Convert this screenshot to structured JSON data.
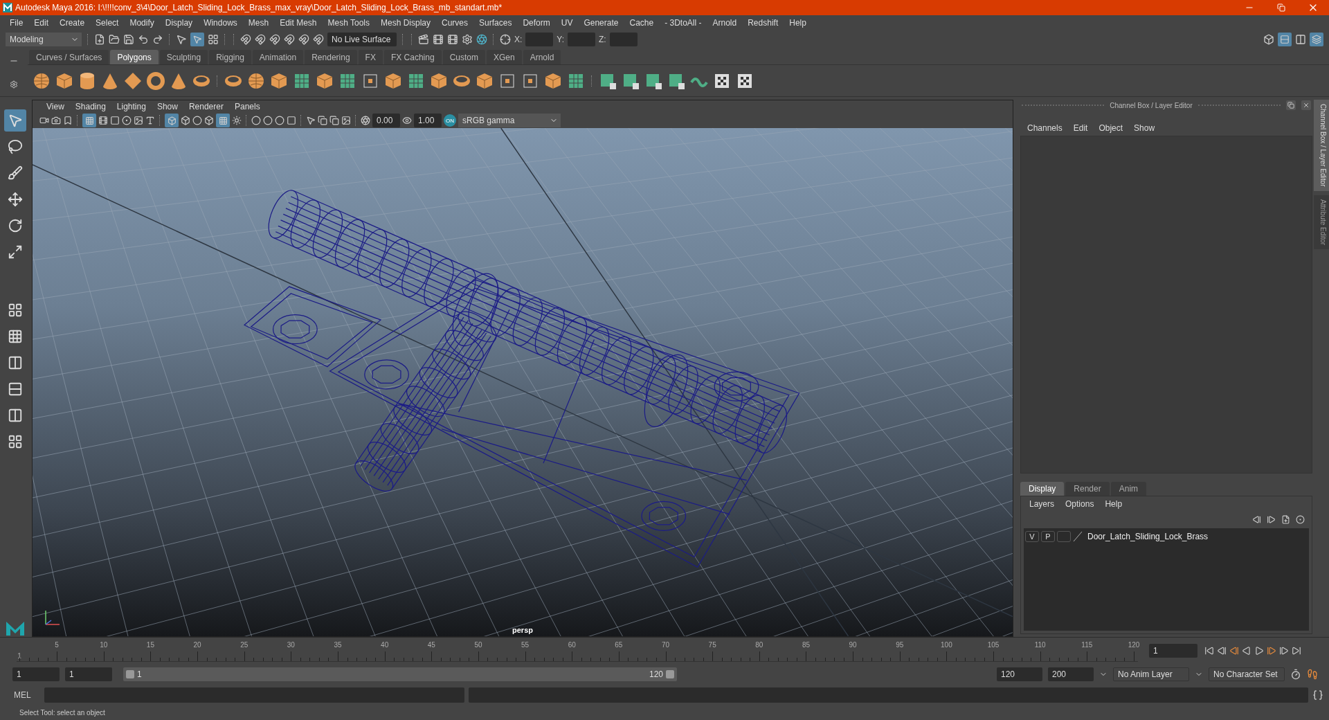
{
  "window": {
    "title": "Autodesk Maya 2016: I:\\!!!!conv_3\\4\\Door_Latch_Sliding_Lock_Brass_max_vray\\Door_Latch_Sliding_Lock_Brass_mb_standart.mb*"
  },
  "menu": [
    "File",
    "Edit",
    "Create",
    "Select",
    "Modify",
    "Display",
    "Windows",
    "Mesh",
    "Edit Mesh",
    "Mesh Tools",
    "Mesh Display",
    "Curves",
    "Surfaces",
    "Deform",
    "UV",
    "Generate",
    "Cache",
    "- 3DtoAll -",
    "Arnold",
    "Redshift",
    "Help"
  ],
  "status_line": {
    "mode": "Modeling",
    "live_surface": "No Live Surface",
    "x_label": "X:",
    "y_label": "Y:",
    "z_label": "Z:"
  },
  "shelf": {
    "tabs": [
      {
        "label": "Curves / Surfaces",
        "selected": false
      },
      {
        "label": "Polygons",
        "selected": true
      },
      {
        "label": "Sculpting",
        "selected": false
      },
      {
        "label": "Rigging",
        "selected": false
      },
      {
        "label": "Animation",
        "selected": false
      },
      {
        "label": "Rendering",
        "selected": false
      },
      {
        "label": "FX",
        "selected": false
      },
      {
        "label": "FX Caching",
        "selected": false
      },
      {
        "label": "Custom",
        "selected": false
      },
      {
        "label": "XGen",
        "selected": false
      },
      {
        "label": "Arnold",
        "selected": false
      }
    ]
  },
  "viewport": {
    "menu": [
      "View",
      "Shading",
      "Lighting",
      "Show",
      "Renderer",
      "Panels"
    ],
    "exposure": "0.00",
    "gamma": "1.00",
    "color_management": "ON",
    "color_space": "sRGB gamma",
    "camera": "persp"
  },
  "channel_box": {
    "title": "Channel Box / Layer Editor",
    "menu": [
      "Channels",
      "Edit",
      "Object",
      "Show"
    ]
  },
  "side_tabs": [
    {
      "label": "Channel Box / Layer Editor",
      "selected": true
    },
    {
      "label": "Attribute Editor",
      "selected": false
    }
  ],
  "layer_editor": {
    "tabs": [
      {
        "label": "Display",
        "selected": true
      },
      {
        "label": "Render",
        "selected": false
      },
      {
        "label": "Anim",
        "selected": false
      }
    ],
    "menu": [
      "Layers",
      "Options",
      "Help"
    ],
    "layers": [
      {
        "visible": "V",
        "playback": "P",
        "name": "Door_Latch_Sliding_Lock_Brass"
      }
    ]
  },
  "time_slider": {
    "start": "1",
    "ticks": [
      "5",
      "10",
      "15",
      "20",
      "25",
      "30",
      "35",
      "40",
      "45",
      "50",
      "55",
      "60",
      "65",
      "70",
      "75",
      "80",
      "85",
      "90",
      "95",
      "100",
      "105",
      "110",
      "115",
      "120"
    ],
    "current_frame": "1"
  },
  "range_slider": {
    "start": "1",
    "playback_start": "1",
    "range_start": "1",
    "range_end": "120",
    "level": 1,
    "playback_end": "120",
    "end": "200",
    "anim_layer": "No Anim Layer",
    "character_set": "No Character Set"
  },
  "command_line": {
    "label": "MEL"
  },
  "help_line": "Select Tool: select an object"
}
